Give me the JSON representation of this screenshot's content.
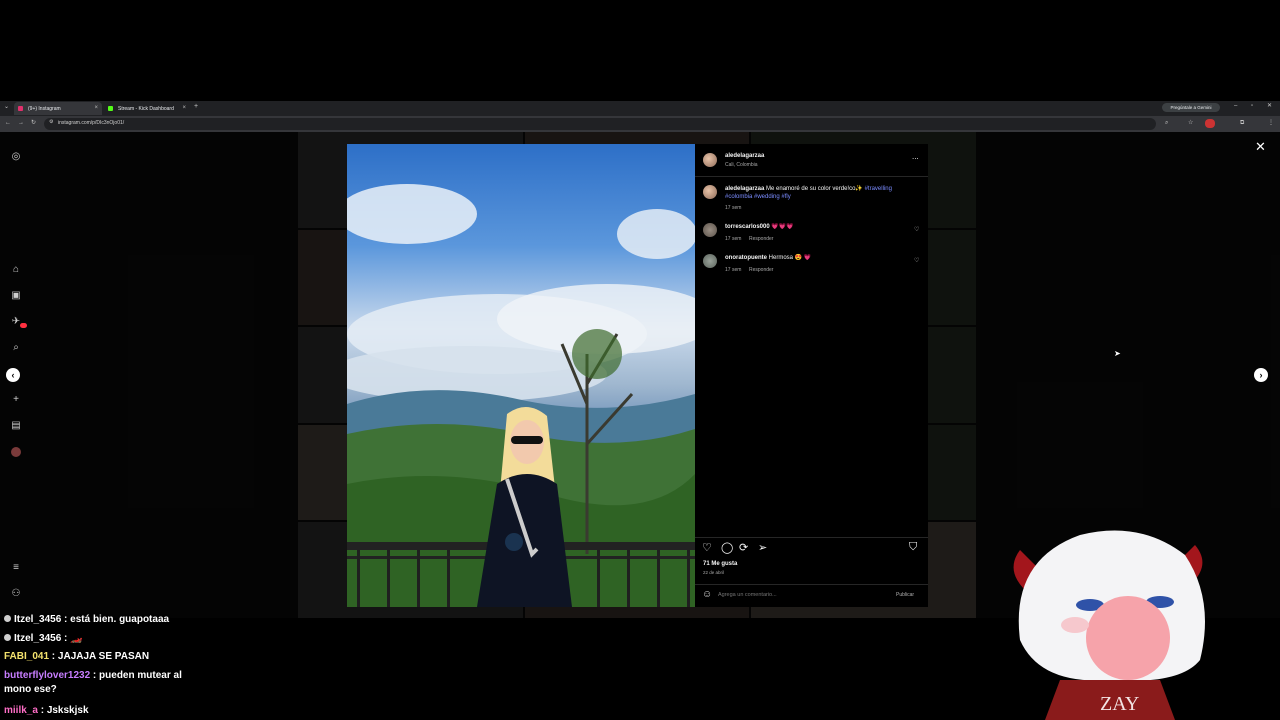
{
  "browser": {
    "tabs": [
      {
        "label": "(9+) Instagram",
        "color": "#e1306c"
      },
      {
        "label": "Stream - Kick Dashboard",
        "color": "#53fc18"
      }
    ],
    "new_tab": "+",
    "url": "instagram.com/p/DIc3nOjo01/",
    "gemini_label": "Pregúntale a Gemini"
  },
  "post": {
    "username": "aledelagarzaa",
    "location": "Cali, Colombia",
    "more": "...",
    "caption_user": "aledelagarzaa",
    "caption_text": "Me enamoré de su color verde!co✨",
    "caption_tags": "#travelling #colombia #wedding #fly",
    "caption_time": "17 sem",
    "comments": [
      {
        "user": "torrescarlos000",
        "text": "💗💗💗",
        "time": "17 sem",
        "reply": "Responder"
      },
      {
        "user": "onoratopuente",
        "text": "Hermosa 😍 💗",
        "time": "17 sem",
        "reply": "Responder"
      }
    ],
    "likes": "71 Me gusta",
    "date": "22 de abril",
    "comment_placeholder": "Agrega un comentario...",
    "publish": "Publicar"
  },
  "chat": [
    {
      "user": "Itzel_3456",
      "message": "está bien. guapotaaa",
      "color": "#ffffff",
      "badge": true
    },
    {
      "user": "Itzel_3456",
      "message": "🏎️",
      "color": "#ffffff",
      "badge": true
    },
    {
      "user": "FABI_041",
      "message": "JAJAJA SE PASAN",
      "color": "#f5e36e",
      "badge": false
    },
    {
      "user": "butterflylover1232",
      "message": "pueden mutear al mono ese?",
      "color": "#c77dff",
      "badge": false
    },
    {
      "user": "miilk_a",
      "message": "Jskskjsk",
      "color": "#ff6ec7",
      "badge": false
    }
  ],
  "vtuber_sign": "ZAY",
  "icons": [
    "instagram-icon",
    "home-icon",
    "reels-icon",
    "messages-icon",
    "search-icon",
    "create-icon",
    "dashboard-icon",
    "profile-icon",
    "menu-icon",
    "heart-icon",
    "comment-icon",
    "repost-icon",
    "share-icon",
    "bookmark-icon",
    "emoji-icon",
    "close-icon",
    "chevron-left-icon",
    "chevron-right-icon"
  ]
}
